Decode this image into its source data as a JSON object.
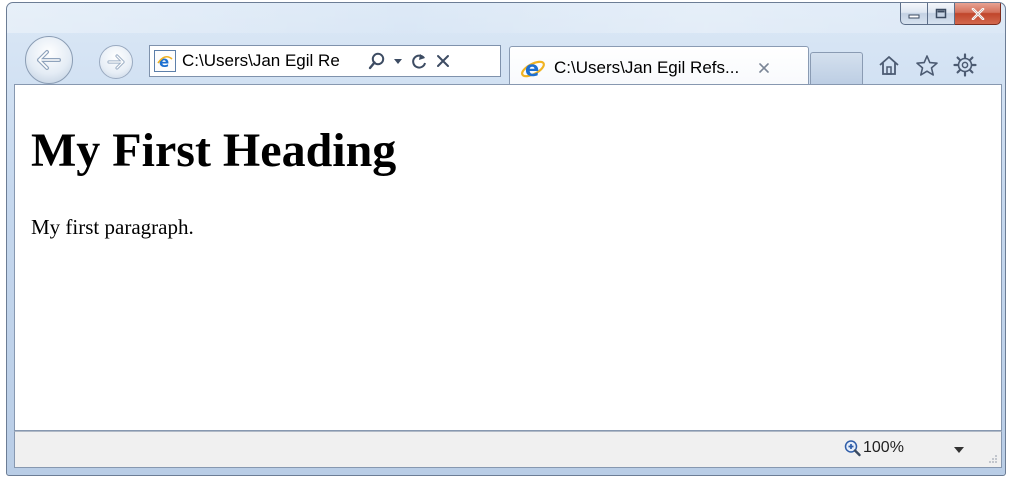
{
  "browser": {
    "address": {
      "value": "C:\\Users\\Jan Egil Re"
    },
    "tab": {
      "title": "C:\\Users\\Jan Egil Refs...",
      "close_glyph": "×"
    },
    "icons": {
      "back": "back-arrow-icon",
      "forward": "forward-arrow-icon",
      "page": "ie-page-icon",
      "search": "search-icon",
      "dropdown": "dropdown-icon",
      "refresh": "refresh-icon",
      "stop": "stop-icon",
      "home": "home-icon",
      "favorites": "star-icon",
      "tools": "gear-icon"
    }
  },
  "page": {
    "heading": "My First Heading",
    "paragraph": "My first paragraph."
  },
  "status_bar": {
    "zoom_label": "100%"
  },
  "colors": {
    "frame": "#c6d8ee",
    "close_button": "#c0452b",
    "ie_blue": "#1c6fd1",
    "ie_ring": "#f0b323"
  }
}
